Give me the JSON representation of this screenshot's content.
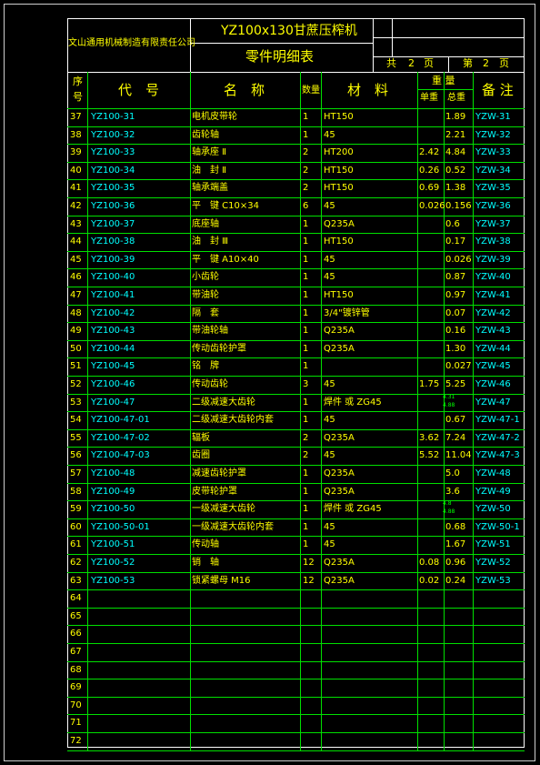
{
  "company": "文山通用机械制造有限责任公司",
  "drawing_title": "YZ100x130甘蔗压榨机",
  "sheet_title": "零件明细表",
  "sheet_total_label": "共",
  "sheet_total": "2",
  "sheet_current_label": "第",
  "sheet_current": "2",
  "page_unit": "页",
  "headers": {
    "seq_line1": "序",
    "seq_line2": "号",
    "code": "代　号",
    "name": "名　称",
    "qty": "数量",
    "material": "材　料",
    "weight": "重 量",
    "unit_weight": "单重",
    "total_weight": "总重",
    "remark": "备 注"
  },
  "rows": [
    {
      "seq": "37",
      "code": "YZ100-31",
      "name": "电机皮带轮",
      "qty": "1",
      "material": "HT150",
      "unit": "",
      "total": "1.89",
      "remark": "YZW-31"
    },
    {
      "seq": "38",
      "code": "YZ100-32",
      "name": "齿轮轴",
      "qty": "1",
      "material": "45",
      "unit": "",
      "total": "2.21",
      "remark": "YZW-32"
    },
    {
      "seq": "39",
      "code": "YZ100-33",
      "name": "轴承座 Ⅱ",
      "qty": "2",
      "material": "HT200",
      "unit": "2.42",
      "total": "4.84",
      "remark": "YZW-33"
    },
    {
      "seq": "40",
      "code": "YZ100-34",
      "name": "油　封 Ⅱ",
      "qty": "2",
      "material": "HT150",
      "unit": "0.26",
      "total": "0.52",
      "remark": "YZW-34"
    },
    {
      "seq": "41",
      "code": "YZ100-35",
      "name": "轴承端盖",
      "qty": "2",
      "material": "HT150",
      "unit": "0.69",
      "total": "1.38",
      "remark": "YZW-35"
    },
    {
      "seq": "42",
      "code": "YZ100-36",
      "name": "平　键 C10×34",
      "qty": "6",
      "material": "45",
      "unit": "0.026",
      "total": "0.156",
      "remark": "YZW-36"
    },
    {
      "seq": "43",
      "code": "YZ100-37",
      "name": "底座轴",
      "qty": "1",
      "material": "Q235A",
      "unit": "",
      "total": "0.6",
      "remark": "YZW-37"
    },
    {
      "seq": "44",
      "code": "YZ100-38",
      "name": "油　封 Ⅲ",
      "qty": "1",
      "material": "HT150",
      "unit": "",
      "total": "0.17",
      "remark": "YZW-38"
    },
    {
      "seq": "45",
      "code": "YZ100-39",
      "name": "平　键 A10×40",
      "qty": "1",
      "material": "45",
      "unit": "",
      "total": "0.026",
      "remark": "YZW-39"
    },
    {
      "seq": "46",
      "code": "YZ100-40",
      "name": "小齿轮",
      "qty": "1",
      "material": "45",
      "unit": "",
      "total": "0.87",
      "remark": "YZW-40"
    },
    {
      "seq": "47",
      "code": "YZ100-41",
      "name": "带油轮",
      "qty": "1",
      "material": "HT150",
      "unit": "",
      "total": "0.97",
      "remark": "YZW-41"
    },
    {
      "seq": "48",
      "code": "YZ100-42",
      "name": "隔　套",
      "qty": "1",
      "material": "3/4\"镀锌管",
      "unit": "",
      "total": "0.07",
      "remark": "YZW-42"
    },
    {
      "seq": "49",
      "code": "YZ100-43",
      "name": "带油轮轴",
      "qty": "1",
      "material": "Q235A",
      "unit": "",
      "total": "0.16",
      "remark": "YZW-43"
    },
    {
      "seq": "50",
      "code": "YZ100-44",
      "name": "传动齿轮护罩",
      "qty": "1",
      "material": "Q235A",
      "unit": "",
      "total": "1.30",
      "remark": "YZW-44"
    },
    {
      "seq": "51",
      "code": "YZ100-45",
      "name": "铭　牌",
      "qty": "1",
      "material": "",
      "unit": "",
      "total": "0.027",
      "remark": "YZW-45"
    },
    {
      "seq": "52",
      "code": "YZ100-46",
      "name": "传动齿轮",
      "qty": "3",
      "material": "45",
      "unit": "1.75",
      "total": "5.25",
      "remark": "YZW-46"
    },
    {
      "seq": "53",
      "code": "YZ100-47",
      "name": "二级减速大齿轮",
      "qty": "1",
      "material": "焊件 或 ZG45",
      "unit": "",
      "total": "",
      "remark": "YZW-47"
    },
    {
      "seq": "54",
      "code": "YZ100-47-01",
      "name": "二级减速大齿轮内套",
      "qty": "1",
      "material": "45",
      "unit": "",
      "total": "0.67",
      "remark": "YZW-47-1"
    },
    {
      "seq": "55",
      "code": "YZ100-47-02",
      "name": "辐板",
      "qty": "2",
      "material": "Q235A",
      "unit": "3.62",
      "total": "7.24",
      "remark": "YZW-47-2"
    },
    {
      "seq": "56",
      "code": "YZ100-47-03",
      "name": "齿圈",
      "qty": "2",
      "material": "45",
      "unit": "5.52",
      "total": "11.04",
      "remark": "YZW-47-3"
    },
    {
      "seq": "57",
      "code": "YZ100-48",
      "name": "减速齿轮护罩",
      "qty": "1",
      "material": "Q235A",
      "unit": "",
      "total": "5.0",
      "remark": "YZW-48"
    },
    {
      "seq": "58",
      "code": "YZ100-49",
      "name": "皮带轮护罩",
      "qty": "1",
      "material": "Q235A",
      "unit": "",
      "total": "3.6",
      "remark": "YZW-49"
    },
    {
      "seq": "59",
      "code": "YZ100-50",
      "name": "一级减速大齿轮",
      "qty": "1",
      "material": "焊件 或 ZG45",
      "unit": "",
      "total": "",
      "remark": "YZW-50"
    },
    {
      "seq": "60",
      "code": "YZ100-50-01",
      "name": "一级减速大齿轮内套",
      "qty": "1",
      "material": "45",
      "unit": "",
      "total": "0.68",
      "remark": "YZW-50-1"
    },
    {
      "seq": "61",
      "code": "YZ100-51",
      "name": "传动轴",
      "qty": "1",
      "material": "45",
      "unit": "",
      "total": "1.67",
      "remark": "YZW-51"
    },
    {
      "seq": "62",
      "code": "YZ100-52",
      "name": "销　轴",
      "qty": "12",
      "material": "Q235A",
      "unit": "0.08",
      "total": "0.96",
      "remark": "YZW-52"
    },
    {
      "seq": "63",
      "code": "YZ100-53",
      "name": "锁紧螺母 M16",
      "qty": "12",
      "material": "Q235A",
      "unit": "0.02",
      "total": "0.24",
      "remark": "YZW-53"
    },
    {
      "seq": "64",
      "code": "",
      "name": "",
      "qty": "",
      "material": "",
      "unit": "",
      "total": "",
      "remark": ""
    },
    {
      "seq": "65",
      "code": "",
      "name": "",
      "qty": "",
      "material": "",
      "unit": "",
      "total": "",
      "remark": ""
    },
    {
      "seq": "66",
      "code": "",
      "name": "",
      "qty": "",
      "material": "",
      "unit": "",
      "total": "",
      "remark": ""
    },
    {
      "seq": "67",
      "code": "",
      "name": "",
      "qty": "",
      "material": "",
      "unit": "",
      "total": "",
      "remark": ""
    },
    {
      "seq": "68",
      "code": "",
      "name": "",
      "qty": "",
      "material": "",
      "unit": "",
      "total": "",
      "remark": ""
    },
    {
      "seq": "69",
      "code": "",
      "name": "",
      "qty": "",
      "material": "",
      "unit": "",
      "total": "",
      "remark": ""
    },
    {
      "seq": "70",
      "code": "",
      "name": "",
      "qty": "",
      "material": "",
      "unit": "",
      "total": "",
      "remark": ""
    },
    {
      "seq": "71",
      "code": "",
      "name": "",
      "qty": "",
      "material": "",
      "unit": "",
      "total": "",
      "remark": ""
    },
    {
      "seq": "72",
      "code": "",
      "name": "",
      "qty": "",
      "material": "",
      "unit": "",
      "total": "",
      "remark": ""
    }
  ],
  "small_notes": [
    {
      "text": "4.31",
      "row": "53"
    },
    {
      "text": "4.88",
      "row": "53"
    },
    {
      "text": "4.8",
      "row": "59"
    },
    {
      "text": "4.88",
      "row": "59"
    }
  ],
  "colors": {
    "background": "#000000",
    "grid": "#00e000",
    "border": "#ffffff",
    "text_yellow": "#ffff00",
    "text_green": "#00ff00",
    "text_cyan": "#00ffff"
  }
}
